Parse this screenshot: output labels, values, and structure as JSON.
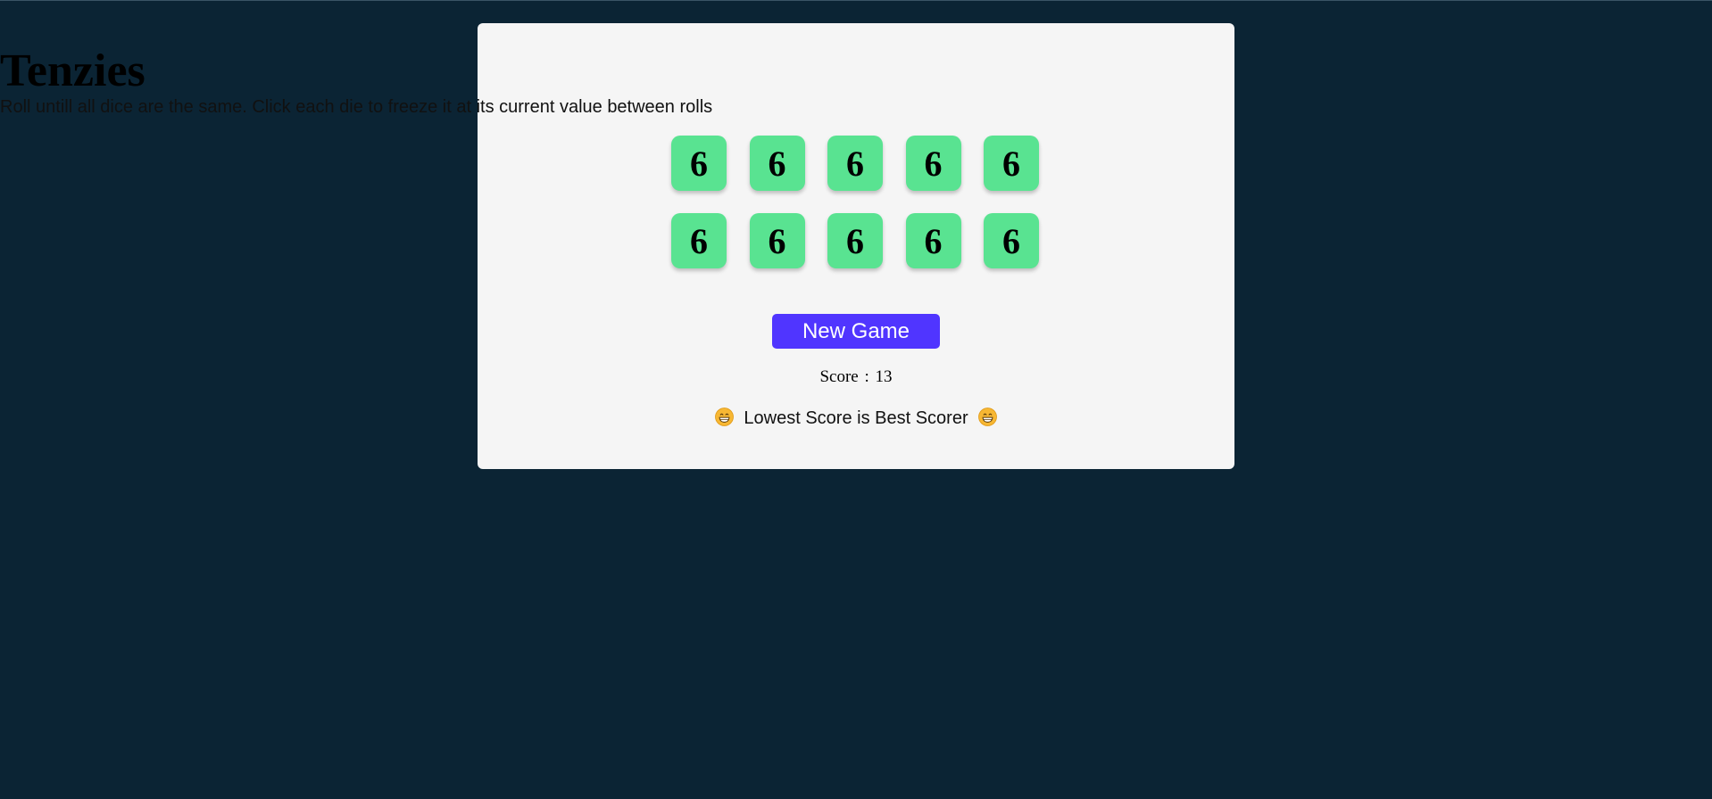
{
  "game": {
    "title": "Tenzies",
    "instructions": "Roll untill all dice are the same. Click each die to freeze it at its current value between rolls",
    "dice": [
      6,
      6,
      6,
      6,
      6,
      6,
      6,
      6,
      6,
      6
    ],
    "new_game_label": "New Game",
    "score_label": "Score",
    "score_separator": ":",
    "score_value": 13,
    "tagline": "Lowest Score is Best Scorer",
    "tagline_icon": "grinning-face-icon"
  },
  "colors": {
    "page_background": "#0b2434",
    "card_background": "#f5f5f5",
    "die_color": "#59e391",
    "button_color": "#5035ff",
    "button_text": "#ffffff"
  }
}
